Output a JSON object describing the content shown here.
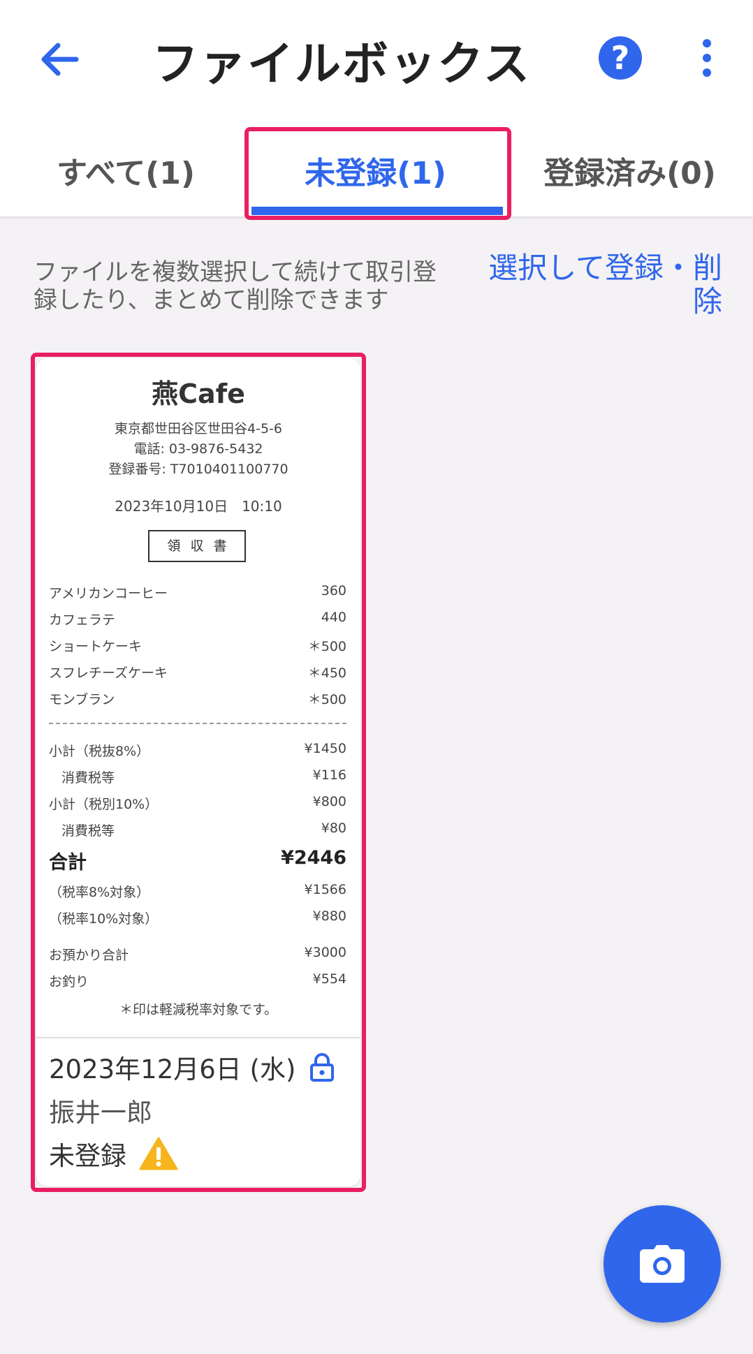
{
  "header": {
    "title": "ファイルボックス",
    "help_label": "?"
  },
  "tabs": [
    {
      "label": "すべて(1)"
    },
    {
      "label": "未登録(1)",
      "selected": true
    },
    {
      "label": "登録済み(0)"
    }
  ],
  "description": "ファイルを複数選択して続けて取引登録したり、まとめて削除できます",
  "select_link": "選択して登録・削除",
  "receipt": {
    "shop": "燕Cafe",
    "address": "東京都世田谷区世田谷4-5-6",
    "tel": "電話: 03-9876-5432",
    "regno": "登録番号: T7010401100770",
    "date": "2023年10月10日　10:10",
    "title": "領収書",
    "items": [
      {
        "name": "アメリカンコーヒー",
        "price": "360"
      },
      {
        "name": "カフェラテ",
        "price": "440"
      },
      {
        "name": "ショートケーキ",
        "price": "＊500"
      },
      {
        "name": "スフレチーズケーキ",
        "price": "＊450"
      },
      {
        "name": "モンブラン",
        "price": "＊500"
      }
    ],
    "subtotal8_label": "小計（税抜8%）",
    "subtotal8": "¥1450",
    "tax8_label": "消費税等",
    "tax8": "¥116",
    "subtotal10_label": "小計（税別10%）",
    "subtotal10": "¥800",
    "tax10_label": "消費税等",
    "tax10": "¥80",
    "total_label": "合計",
    "total": "¥2446",
    "rate8_label": "（税率8%対象）",
    "rate8": "¥1566",
    "rate10_label": "（税率10%対象）",
    "rate10": "¥880",
    "deposit_label": "お預かり合計",
    "deposit": "¥3000",
    "change_label": "お釣り",
    "change": "¥554",
    "note": "＊印は軽減税率対象です。"
  },
  "card": {
    "date": "2023年12月6日 (水)",
    "name": "振井一郎",
    "status": "未登録"
  },
  "colors": {
    "accent": "#2f66ec",
    "highlight": "#e91e63",
    "warning": "#f6b51d"
  },
  "icons": {
    "back": "arrow-left-icon",
    "help": "question-icon",
    "more": "more-vert-icon",
    "lock": "lock-icon",
    "warning": "warning-icon",
    "camera": "camera-icon"
  }
}
